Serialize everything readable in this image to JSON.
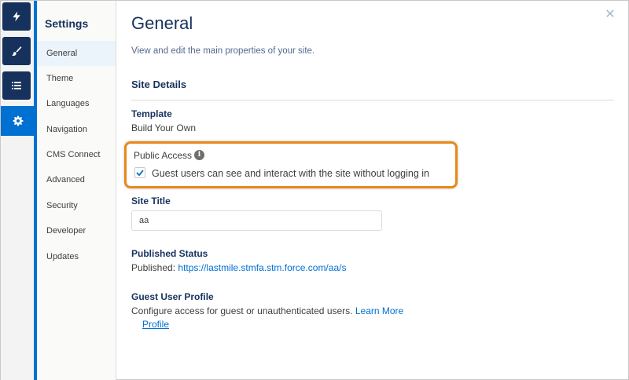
{
  "rail": {
    "items": [
      {
        "icon": "lightning-icon"
      },
      {
        "icon": "brush-icon"
      },
      {
        "icon": "list-icon"
      },
      {
        "icon": "gear-icon",
        "active": true
      }
    ]
  },
  "settings": {
    "title": "Settings",
    "items": [
      {
        "label": "General",
        "active": true
      },
      {
        "label": "Theme"
      },
      {
        "label": "Languages"
      },
      {
        "label": "Navigation"
      },
      {
        "label": "CMS Connect"
      },
      {
        "label": "Advanced"
      },
      {
        "label": "Security"
      },
      {
        "label": "Developer"
      },
      {
        "label": "Updates"
      }
    ]
  },
  "main": {
    "title": "General",
    "description": "View and edit the main properties of your site.",
    "close_glyph": "✕",
    "section_title": "Site Details",
    "template_label": "Template",
    "template_value": "Build Your Own",
    "public_access": {
      "label": "Public Access",
      "info_glyph": "i",
      "checkbox_label": "Guest users can see and interact with the site without logging in",
      "checked": true
    },
    "site_title": {
      "label": "Site Title",
      "value": "aa"
    },
    "published_status": {
      "label": "Published Status",
      "prefix": "Published:",
      "url": "https://lastmile.stmfa.stm.force.com/aa/s"
    },
    "guest_user_profile": {
      "label": "Guest User Profile",
      "description": "Configure access for guest or unauthenticated users.",
      "learn_more": "Learn More",
      "profile_link": "Profile"
    }
  },
  "colors": {
    "accent": "#0070d2",
    "rail_dark": "#16325c",
    "highlight": "#e8891c"
  }
}
